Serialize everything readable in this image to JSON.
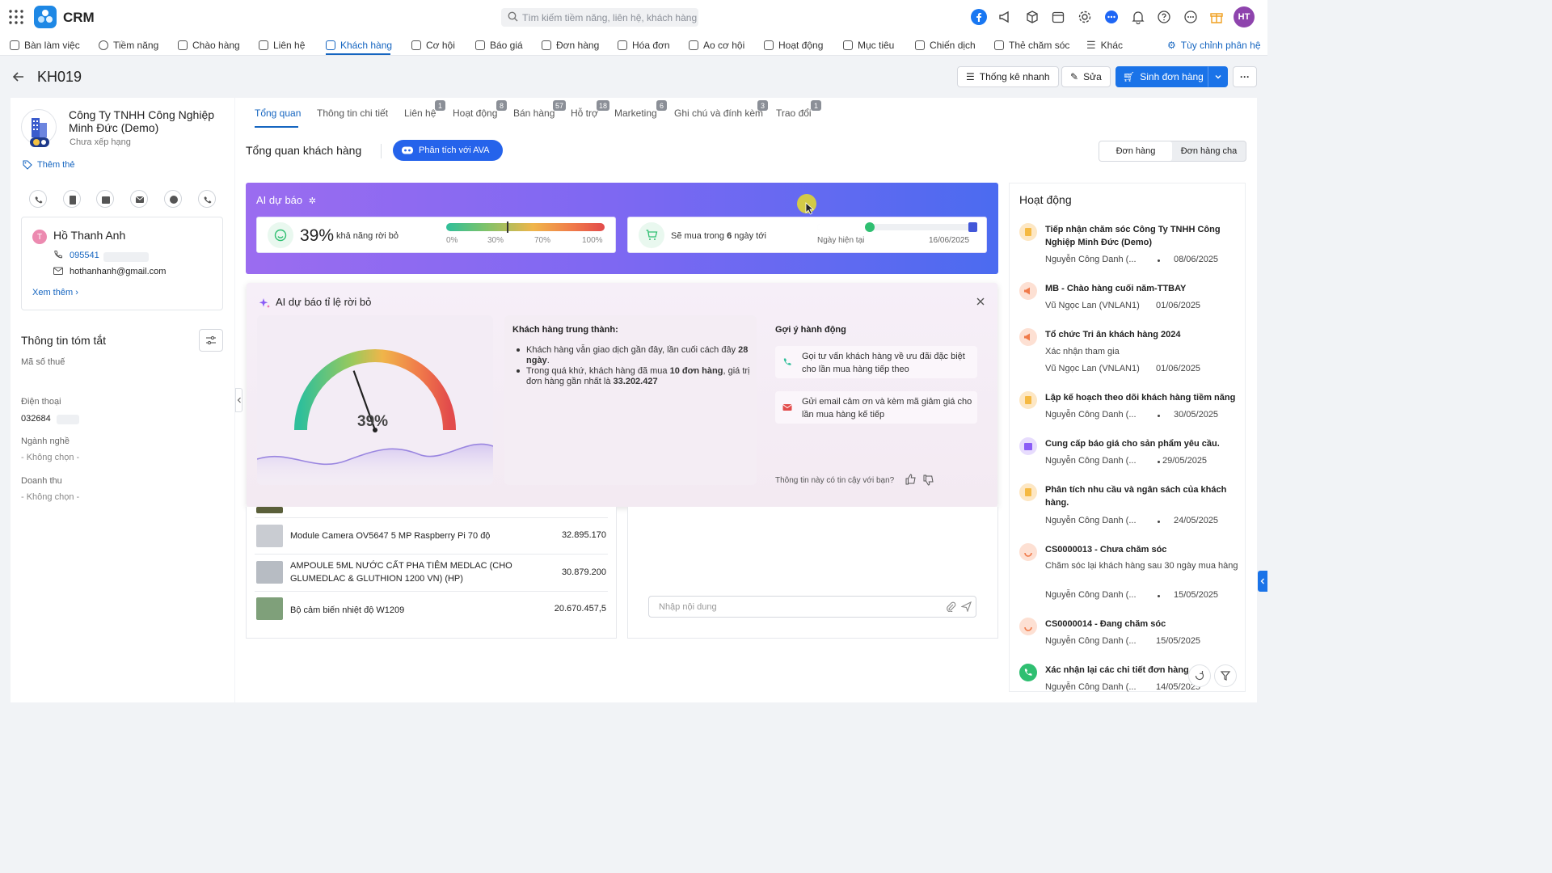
{
  "app": {
    "name": "CRM"
  },
  "search": {
    "placeholder": "Tìm kiếm tiềm năng, liên hệ, khách hàng"
  },
  "user": {
    "initials": "HT"
  },
  "nav": {
    "items": [
      "Bàn làm việc",
      "Tiềm năng",
      "Chào hàng",
      "Liên hệ",
      "Khách hàng",
      "Cơ hội",
      "Báo giá",
      "Đơn hàng",
      "Hóa đơn",
      "Ao cơ hội",
      "Hoạt động",
      "Mục tiêu",
      "Chiến dịch",
      "Thẻ chăm sóc",
      "Khác"
    ],
    "active": "Khách hàng",
    "customize": "Tùy chỉnh phân hệ"
  },
  "header": {
    "title": "KH019",
    "quick_stats": "Thống kê nhanh",
    "edit": "Sửa",
    "create_order": "Sinh đơn hàng"
  },
  "customer": {
    "company": "Công Ty TNHH Công Nghiệp Minh Đức (Demo)",
    "rank": "Chưa xếp hạng",
    "add_tag": "Thêm thẻ",
    "contact": {
      "initial": "T",
      "name": "Hồ Thanh Anh",
      "phone": "095541",
      "email": "hothanhanh@gmail.com",
      "more": "Xem thêm"
    },
    "summary": {
      "title": "Thông tin tóm tắt",
      "tax_label": "Mã số thuế",
      "phone_label": "Điện thoại",
      "phone_value": "032684",
      "industry_label": "Ngành nghề",
      "industry_value": "- Không chọn -",
      "revenue_label": "Doanh thu",
      "revenue_value": "- Không chọn -"
    }
  },
  "tabs": [
    {
      "label": "Tổng quan",
      "badge": ""
    },
    {
      "label": "Thông tin chi tiết",
      "badge": ""
    },
    {
      "label": "Liên hệ",
      "badge": "1"
    },
    {
      "label": "Hoạt động",
      "badge": "8"
    },
    {
      "label": "Bán hàng",
      "badge": "57"
    },
    {
      "label": "Hỗ trợ",
      "badge": "18"
    },
    {
      "label": "Marketing",
      "badge": "6"
    },
    {
      "label": "Ghi chú và đính kèm",
      "badge": "3"
    },
    {
      "label": "Trao đổi",
      "badge": "1"
    }
  ],
  "overview": {
    "title": "Tổng quan khách hàng",
    "ava_button": "Phân tích với AVA",
    "seg_a": "Đơn hàng",
    "seg_b": "Đơn hàng cha"
  },
  "ai_forecast": {
    "title": "AI dự báo",
    "churn_value": "39%",
    "churn_label": "khả năng rời bỏ",
    "churn_ticks": [
      "0%",
      "30%",
      "70%",
      "100%"
    ],
    "churn_fraction": 0.39,
    "buy_text_prefix": "Sẽ mua trong ",
    "buy_days": "6",
    "buy_text_suffix": " ngày tới",
    "today_label": "Ngày hiện tại",
    "target_date": "16/06/2025",
    "today_fraction": 0.33
  },
  "churn_popup": {
    "title": "AI dự báo tỉ lệ rời bỏ",
    "gauge_value": "39%",
    "gauge_fraction": 0.39,
    "loyal_title": "Khách hàng trung thành:",
    "loyal_1a": "Khách hàng vẫn giao dịch gần đây, lần cuối cách đây ",
    "loyal_1b": "28 ngày",
    "loyal_1c": ".",
    "loyal_2a": "Trong quá khứ, khách hàng đã mua ",
    "loyal_2b": "10 đơn hàng",
    "loyal_2c": ", giá trị đơn hàng gần nhất là ",
    "loyal_2d": "33.202.427",
    "actions_title": "Gợi ý hành động",
    "action_1": "Gọi tư vấn khách hàng về ưu đãi đặc biệt cho lần mua hàng tiếp theo",
    "action_2": "Gửi email cảm ơn và kèm mã giảm giá cho lần mua hàng kế tiếp",
    "trust_question": "Thông tin này có tin cậy với bạn?"
  },
  "products": [
    {
      "name": "Module Camera OV5647 5 MP Raspberry Pi 70 độ",
      "value": "32.895.170"
    },
    {
      "name": "AMPOULE 5ML NƯỚC CẤT PHA TIÊM MEDLAC (CHO GLUMEDLAC & GLUTHION 1200 VN) (HP)",
      "value": "30.879.200"
    },
    {
      "name": "Bộ cảm biến nhiệt độ W1209",
      "value": "20.670.457,5"
    }
  ],
  "note": {
    "placeholder": "Nhập nội dung"
  },
  "activity": {
    "title": "Hoạt động",
    "items": [
      {
        "title": "Tiếp nhận chăm sóc Công Ty TNHH Công Nghiệp Minh Đức (Demo)",
        "sub": "",
        "who": "Nguyễn Công Danh (...",
        "date": "08/06/2025",
        "color": "#f5b942"
      },
      {
        "title": "MB - Chào hàng cuối năm-TTBAY",
        "sub": "",
        "who": "Vũ Ngọc Lan (VNLAN1)",
        "date": "01/06/2025",
        "color": "#f07a4a"
      },
      {
        "title": "Tổ chức Tri ân khách hàng 2024",
        "sub": "Xác nhận tham gia",
        "who": "Vũ Ngọc Lan (VNLAN1)",
        "date": "01/06/2025",
        "color": "#f07a4a"
      },
      {
        "title": "Lập kế hoạch theo dõi khách hàng tiềm năng",
        "sub": "",
        "who": "Nguyễn Công Danh (...",
        "date": "30/05/2025",
        "color": "#f5b942"
      },
      {
        "title": "Cung cấp báo giá cho sản phẩm yêu cầu.",
        "sub": "",
        "who": "Nguyễn Công Danh (...",
        "date": "29/05/2025",
        "color": "#8b5cf6"
      },
      {
        "title": "Phân tích nhu cầu và ngân sách của khách hàng.",
        "sub": "",
        "who": "Nguyễn Công Danh (...",
        "date": "24/05/2025",
        "color": "#f5b942"
      },
      {
        "title": "CS0000013 - Chưa chăm sóc",
        "sub": "Chăm sóc lại khách hàng sau 30 ngày mua hàng",
        "who": "Nguyễn Công Danh (...",
        "date": "15/05/2025",
        "color": "#f07a4a"
      },
      {
        "title": "CS0000014 - Đang chăm sóc",
        "sub": "",
        "who": "Nguyễn Công Danh (...",
        "date": "15/05/2025",
        "color": "#f07a4a"
      },
      {
        "title": "Xác nhận lại các chi tiết đơn hàng.",
        "sub": "",
        "who": "Nguyễn Công Danh (...",
        "date": "14/05/2025",
        "color": "#2fbf71"
      }
    ]
  }
}
